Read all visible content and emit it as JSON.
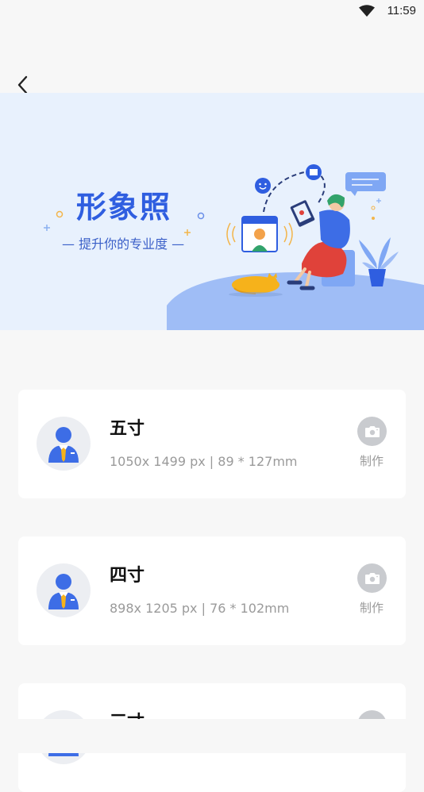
{
  "status_bar": {
    "time": "11:59"
  },
  "banner": {
    "title": "形象照",
    "subtitle": "— 提升你的专业度 —"
  },
  "cards": [
    {
      "title": "五寸",
      "spec": "1050x 1499 px | 89 * 127mm",
      "make_label": "制作"
    },
    {
      "title": "四寸",
      "spec": "898x 1205 px | 76 * 102mm",
      "make_label": "制作"
    },
    {
      "title": "三寸",
      "spec": "",
      "make_label": ""
    }
  ],
  "colors": {
    "accent": "#2f5ee0",
    "banner_bg": "#e8f1fd",
    "page_bg": "#f7f7f7",
    "avatar_suit": "#3d6de6",
    "avatar_tie": "#f6b21b"
  },
  "icons": {
    "back": "chevron-left-icon",
    "wifi": "wifi-icon",
    "camera": "camera-icon"
  }
}
